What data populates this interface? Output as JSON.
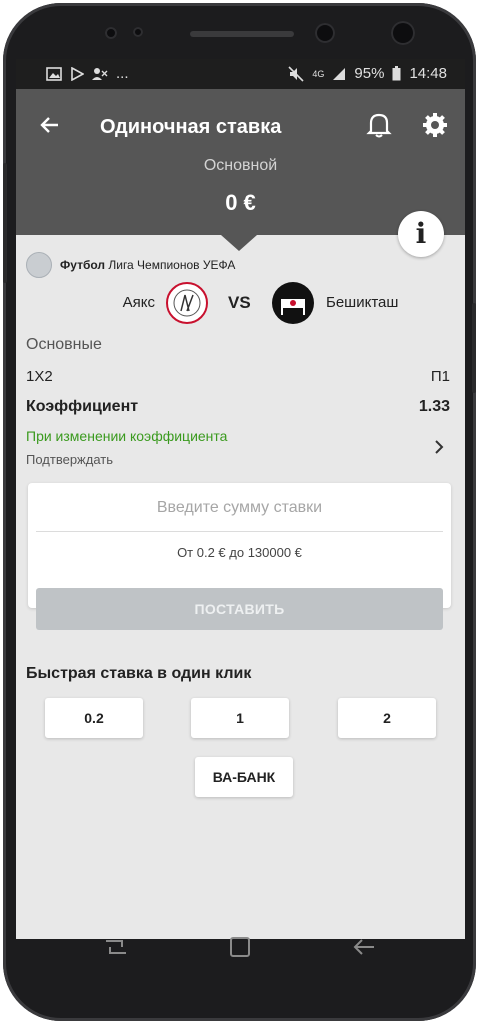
{
  "status": {
    "battery": "95%",
    "time": "14:48",
    "network": "4G",
    "more": "..."
  },
  "header": {
    "title": "Одиночная ставка",
    "subtitle": "Основной",
    "amount": "0 €"
  },
  "match": {
    "sport": "Футбол",
    "league": "Лига Чемпионов УЕФА",
    "team1": "Аякс",
    "vs": "VS",
    "team2": "Бешикташ"
  },
  "bet": {
    "section": "Основные",
    "market": "1Х2",
    "outcome": "П1",
    "coef_label": "Коэффициент",
    "coef_value": "1.33",
    "on_change": "При изменении коэффициента",
    "confirm": "Подтверждать"
  },
  "stake": {
    "placeholder": "Введите сумму ставки",
    "range": "От 0.2 € до 130000 €",
    "place_button": "ПОСТАВИТЬ"
  },
  "quick": {
    "title": "Быстрая ставка в один клик",
    "buttons": [
      "0.2",
      "1",
      "2"
    ],
    "all_in": "ВА-БАНК"
  },
  "colors": {
    "header": "#565656",
    "accent_green": "#3a9a1e",
    "disabled_button": "#bfc3c6"
  }
}
